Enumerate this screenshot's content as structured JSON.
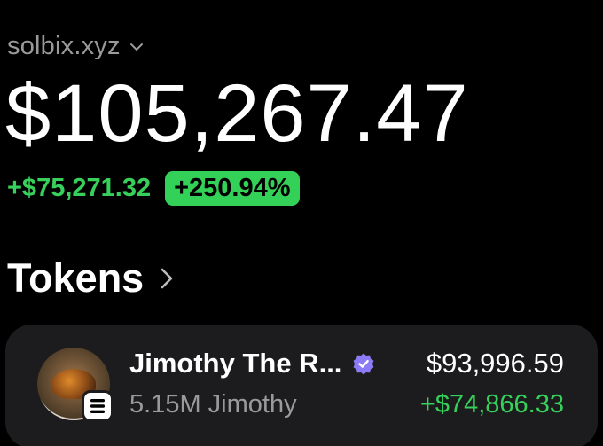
{
  "wallet": {
    "name": "solbix.xyz"
  },
  "portfolio": {
    "balance": "$105,267.47",
    "pnl_amount": "+$75,271.32",
    "pnl_percent": "+250.94%"
  },
  "tokens": {
    "title": "Tokens",
    "items": [
      {
        "name": "Jimothy The R...",
        "amount_symbol": "5.15M Jimothy",
        "value": "$93,996.59",
        "change": "+$74,866.33",
        "verified": true,
        "chain_icon": "solana-icon"
      }
    ]
  },
  "colors": {
    "positive": "#36d05a",
    "badge_bg": "#34d158",
    "card_bg": "#1c1c1e",
    "muted": "#9a9a9a",
    "verified": "#8b7cf6"
  }
}
